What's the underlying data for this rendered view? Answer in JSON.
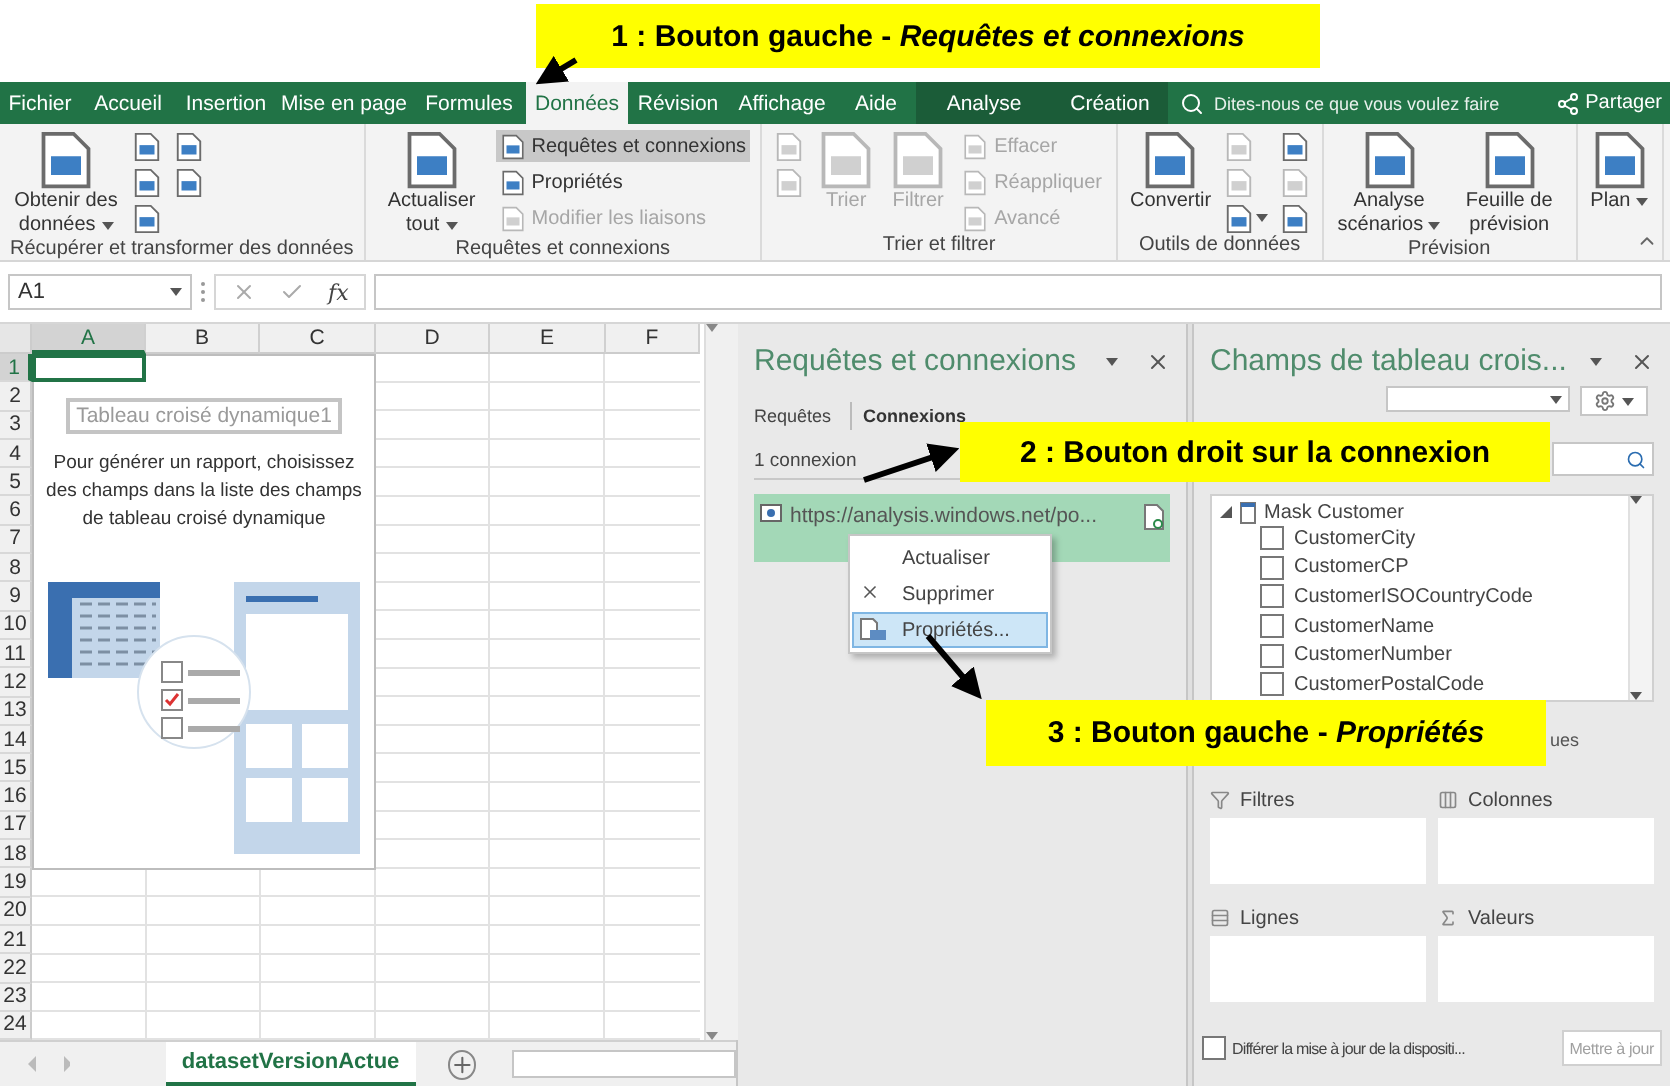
{
  "annotations": [
    {
      "text": "1 : Bouton gauche - *Requêtes et connexions*"
    },
    {
      "text": "2 : Bouton droit sur la connexion"
    },
    {
      "text": "3 : Bouton gauche - *Propriétés*"
    }
  ],
  "tabs": [
    {
      "label": "Fichier",
      "selected": false,
      "kind": "normal"
    },
    {
      "label": "Accueil",
      "selected": false,
      "kind": "normal"
    },
    {
      "label": "Insertion",
      "selected": false,
      "kind": "normal"
    },
    {
      "label": "Mise en page",
      "selected": false,
      "kind": "normal"
    },
    {
      "label": "Formules",
      "selected": false,
      "kind": "normal"
    },
    {
      "label": "Données",
      "selected": true,
      "kind": "normal"
    },
    {
      "label": "Révision",
      "selected": false,
      "kind": "normal"
    },
    {
      "label": "Affichage",
      "selected": false,
      "kind": "normal"
    },
    {
      "label": "Aide",
      "selected": false,
      "kind": "normal"
    },
    {
      "label": "Analyse",
      "selected": false,
      "kind": "context"
    },
    {
      "label": "Création",
      "selected": false,
      "kind": "context"
    }
  ],
  "search": {
    "placeholder": "Dites-nous ce que vous voulez faire"
  },
  "share_button": "Partager",
  "ribbon": {
    "groups": [
      {
        "label": "Récupérer et transformer des données",
        "columns": [
          [
            {
              "kind": "large",
              "label": "Obtenir des données",
              "menu": true,
              "disabled": false,
              "selected": false
            }
          ],
          [
            {
              "kind": "icon",
              "menu": false,
              "disabled": false,
              "selected": false
            },
            {
              "kind": "icon",
              "menu": false,
              "disabled": false,
              "selected": false
            },
            {
              "kind": "icon",
              "menu": false,
              "disabled": false,
              "selected": false
            }
          ],
          [
            {
              "kind": "icon",
              "menu": false,
              "disabled": false,
              "selected": false
            },
            {
              "kind": "icon",
              "menu": false,
              "disabled": false,
              "selected": false
            }
          ]
        ]
      },
      {
        "label": "Requêtes et connexions",
        "columns": [
          [
            {
              "kind": "large",
              "label": "Actualiser tout",
              "menu": true,
              "disabled": false,
              "selected": false
            }
          ],
          [
            {
              "kind": "small",
              "label": "Requêtes et connexions",
              "menu": false,
              "disabled": false,
              "selected": true
            },
            {
              "kind": "small",
              "label": "Propriétés",
              "menu": false,
              "disabled": false,
              "selected": false
            },
            {
              "kind": "small",
              "label": "Modifier les liaisons",
              "menu": false,
              "disabled": true,
              "selected": false
            }
          ]
        ]
      },
      {
        "label": "Trier et filtrer",
        "columns": [
          [
            {
              "kind": "icon",
              "menu": false,
              "disabled": true,
              "selected": false
            },
            {
              "kind": "icon",
              "menu": false,
              "disabled": true,
              "selected": false
            }
          ],
          [
            {
              "kind": "large",
              "label": "Trier",
              "menu": false,
              "disabled": true,
              "selected": false
            }
          ],
          [
            {
              "kind": "large",
              "label": "Filtrer",
              "menu": false,
              "disabled": true,
              "selected": false
            }
          ],
          [
            {
              "kind": "small",
              "label": "Effacer",
              "menu": false,
              "disabled": true,
              "selected": false
            },
            {
              "kind": "small",
              "label": "Réappliquer",
              "menu": false,
              "disabled": true,
              "selected": false
            },
            {
              "kind": "small",
              "label": "Avancé",
              "menu": false,
              "disabled": true,
              "selected": false
            }
          ]
        ]
      },
      {
        "label": "Outils de données",
        "columns": [
          [
            {
              "kind": "large",
              "label": "Convertir",
              "menu": false,
              "disabled": false,
              "selected": false
            }
          ],
          [
            {
              "kind": "icon",
              "menu": false,
              "disabled": true,
              "selected": false
            },
            {
              "kind": "icon",
              "menu": false,
              "disabled": true,
              "selected": false
            },
            {
              "kind": "icon",
              "menu": true,
              "disabled": false,
              "selected": false
            }
          ],
          [
            {
              "kind": "icon",
              "menu": false,
              "disabled": false,
              "selected": false
            },
            {
              "kind": "icon",
              "menu": false,
              "disabled": true,
              "selected": false
            },
            {
              "kind": "icon",
              "menu": false,
              "disabled": false,
              "selected": false
            }
          ]
        ]
      },
      {
        "label": "Prévision",
        "columns": [
          [
            {
              "kind": "large",
              "label": "Analyse scénarios",
              "menu": true,
              "disabled": false,
              "selected": false
            }
          ],
          [
            {
              "kind": "large",
              "label": "Feuille de prévision",
              "menu": false,
              "disabled": false,
              "selected": false
            }
          ]
        ]
      },
      {
        "columns": [
          [
            {
              "kind": "large",
              "label": "Plan",
              "menu": true,
              "disabled": false,
              "selected": false
            }
          ]
        ]
      }
    ]
  },
  "formula_bar": {
    "name_box": "A1",
    "function_label": "fx"
  },
  "sheet": {
    "columns": [
      {
        "label": "A",
        "selected": true
      },
      {
        "label": "B",
        "selected": false
      },
      {
        "label": "C",
        "selected": false
      },
      {
        "label": "D",
        "selected": false
      },
      {
        "label": "E",
        "selected": false
      },
      {
        "label": "F",
        "selected": false
      }
    ],
    "rows": [
      {
        "label": "1",
        "selected": true
      },
      {
        "label": "2",
        "selected": false
      },
      {
        "label": "3",
        "selected": false
      },
      {
        "label": "4",
        "selected": false
      },
      {
        "label": "5",
        "selected": false
      },
      {
        "label": "6",
        "selected": false
      },
      {
        "label": "7",
        "selected": false
      },
      {
        "label": "8",
        "selected": false
      },
      {
        "label": "9",
        "selected": false
      },
      {
        "label": "10",
        "selected": false
      },
      {
        "label": "11",
        "selected": false
      },
      {
        "label": "12",
        "selected": false
      },
      {
        "label": "13",
        "selected": false
      },
      {
        "label": "14",
        "selected": false
      },
      {
        "label": "15",
        "selected": false
      },
      {
        "label": "16",
        "selected": false
      },
      {
        "label": "17",
        "selected": false
      },
      {
        "label": "18",
        "selected": false
      },
      {
        "label": "19",
        "selected": false
      },
      {
        "label": "20",
        "selected": false
      },
      {
        "label": "21",
        "selected": false
      },
      {
        "label": "22",
        "selected": false
      },
      {
        "label": "23",
        "selected": false
      },
      {
        "label": "24",
        "selected": false
      }
    ],
    "pivot_placeholder": {
      "title": "Tableau croisé dynamique1",
      "message": "Pour générer un rapport, choisissez des champs dans la liste des champs de tableau croisé dynamique"
    },
    "tabs": [
      {
        "label": "datasetVersionActue",
        "selected": true
      }
    ]
  },
  "queries_pane": {
    "title": "Requêtes et connexions",
    "tabs": [
      {
        "label": "Requêtes",
        "selected": false
      },
      {
        "label": "Connexions",
        "selected": true
      }
    ],
    "count": "1 connexion",
    "connections": [
      {
        "url": "https://analysis.windows.net/po...",
        "selected": true
      }
    ],
    "context_menu": [
      {
        "kind": "refresh",
        "label": "Actualiser",
        "selected": false
      },
      {
        "kind": "delete",
        "label": "Supprimer",
        "selected": false
      },
      {
        "kind": "properties",
        "label": "Propriétés...",
        "selected": true
      }
    ]
  },
  "pivot_pane": {
    "title": "Champs de tableau crois...",
    "tables": [
      {
        "name": "Mask Customer",
        "expanded": true,
        "fields": [
          {
            "label": "CustomerCity",
            "checked": false
          },
          {
            "label": "CustomerCP",
            "checked": false
          },
          {
            "label": "CustomerISOCountryCode",
            "checked": false
          },
          {
            "label": "CustomerName",
            "checked": false
          },
          {
            "label": "CustomerNumber",
            "checked": false
          },
          {
            "label": "CustomerPostalCode",
            "checked": false
          }
        ]
      }
    ],
    "hint_fragment": "ues",
    "areas": [
      {
        "kind": "filters",
        "label": "Filtres"
      },
      {
        "kind": "columns",
        "label": "Colonnes"
      },
      {
        "kind": "rows",
        "label": "Lignes"
      },
      {
        "kind": "values",
        "label": "Valeurs"
      }
    ],
    "defer": {
      "label": "Différer la mise à jour de la dispositi...",
      "checked": false
    },
    "update_button": {
      "label": "Mettre à jour",
      "disabled": true
    }
  }
}
